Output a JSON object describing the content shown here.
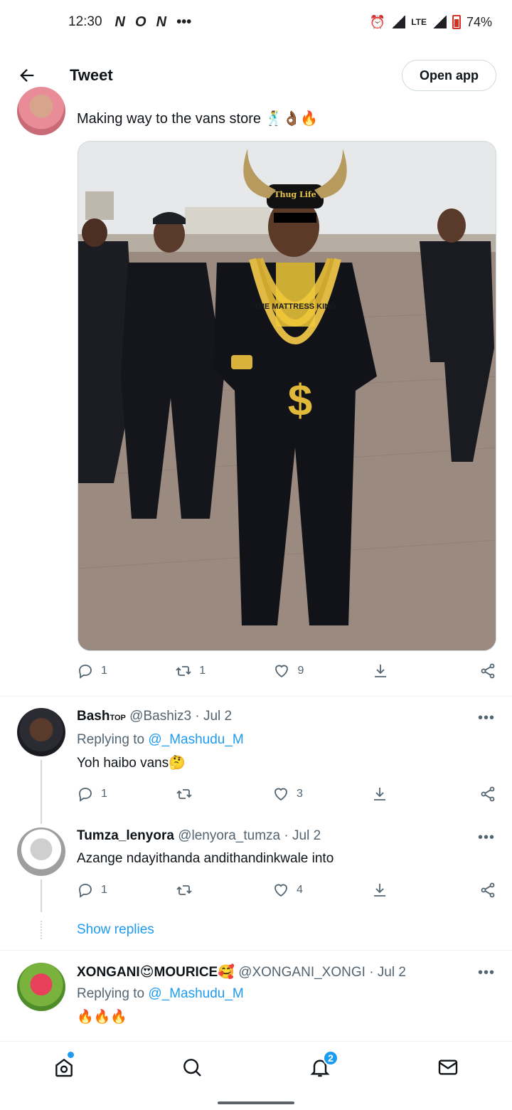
{
  "status_bar": {
    "time": "12:30",
    "left_icons": [
      "N",
      "O",
      "N",
      "•••"
    ],
    "network": "LTE",
    "battery": "74%"
  },
  "header": {
    "title": "Tweet",
    "open_app_label": "Open app"
  },
  "main_tweet": {
    "text": "Making way to the vans store",
    "emojis": "🕺👌🏾🔥",
    "image_text": {
      "cap": "Thug Life",
      "shirt": "THE MATTRESS KING",
      "pendant": "$"
    },
    "actions": {
      "replies": "1",
      "retweets": "1",
      "likes": "9"
    }
  },
  "replies": [
    {
      "name": "Bash",
      "name_badge": "TOP",
      "handle": "@Bashiz3",
      "time": "· Jul 2",
      "replying_prefix": "Replying to",
      "replying_to": "@_Mashudu_M",
      "text": "Yoh haibo vans",
      "text_emoji": "🤔",
      "replies": "1",
      "retweets": "",
      "likes": "3"
    },
    {
      "name": "Tumza_lenyora",
      "handle": "@lenyora_tumza",
      "time": "· Jul 2",
      "text": "Azange ndayithanda andithandinkwale into",
      "replies": "1",
      "retweets": "",
      "likes": "4"
    },
    {
      "name": "XONGANI",
      "name_emoji_1": "😍",
      "name_mid": "MOURICE",
      "name_emoji_2": "🥰",
      "handle": "@XONGANI_XONGI",
      "time": "· Jul 2",
      "replying_prefix": "Replying to",
      "replying_to": "@_Mashudu_M",
      "text": "🔥🔥🔥"
    }
  ],
  "show_replies_label": "Show replies",
  "more_label": "•••",
  "bottom_nav": {
    "items": [
      "home-icon",
      "search-icon",
      "notifications-icon",
      "messages-icon"
    ],
    "notifications_badge": "2"
  },
  "colors": {
    "accent": "#1d9bf0",
    "text": "#0f1419",
    "muted": "#536471"
  }
}
